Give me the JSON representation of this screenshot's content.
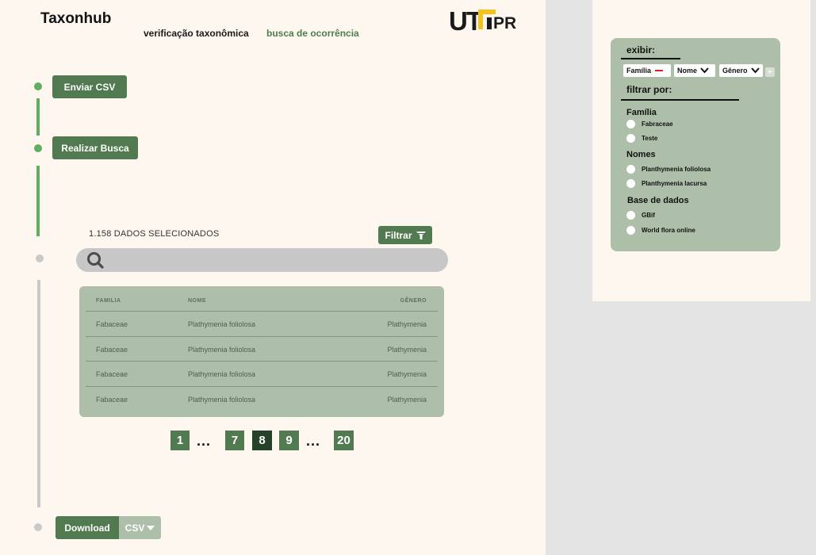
{
  "header": {
    "app_title": "Taxonhub",
    "nav": [
      {
        "label": "verificação taxonômica",
        "active": false
      },
      {
        "label": "busca de ocorrência",
        "active": true
      }
    ],
    "logo_text": "UTFPR"
  },
  "steps": {
    "send_csv_label": "Enviar CSV",
    "search_label": "Realizar Busca"
  },
  "results": {
    "selected_count_text": "1.158 DADOS SELECIONADOS",
    "filter_label": "Filtrar",
    "search_placeholder": ""
  },
  "table": {
    "columns": [
      "FAMILIA",
      "NOME",
      "GÊNERO"
    ],
    "rows": [
      [
        "Fabaceae",
        "Plathymenia foliolosa",
        "Plathymenia"
      ],
      [
        "Fabaceae",
        "Plathymenia foliolosa",
        "Plathymenia"
      ],
      [
        "Fabaceae",
        "Plathymenia foliolosa",
        "Plathymenia"
      ],
      [
        "Fabaceae",
        "Plathymenia foliolosa",
        "Plathymenia"
      ]
    ]
  },
  "pagination": {
    "pages": [
      "1",
      "7",
      "8",
      "9",
      "20"
    ],
    "current": "8",
    "ellipsis": "..."
  },
  "download": {
    "label": "Download",
    "format": "CSV"
  },
  "filter_panel": {
    "display_heading": "exibir:",
    "chips": [
      "Família",
      "Nome",
      "Gênero"
    ],
    "filter_heading": "filtrar por:",
    "groups": [
      {
        "title": "Família",
        "options": [
          "Fabraceae",
          "Teste"
        ]
      },
      {
        "title": "Nomes",
        "options": [
          "Planthymenia foliolosa",
          "Planthymenia lacursa"
        ]
      },
      {
        "title": "Base de dados",
        "options": [
          "GBif",
          "World flora online"
        ]
      }
    ]
  },
  "colors": {
    "accent_green": "#527a50",
    "dark_green": "#25412a",
    "sage": "#adbfa9",
    "step_green": "#5fae62",
    "background": "#fdf7f0",
    "logo_yellow": "#f3c21b"
  }
}
